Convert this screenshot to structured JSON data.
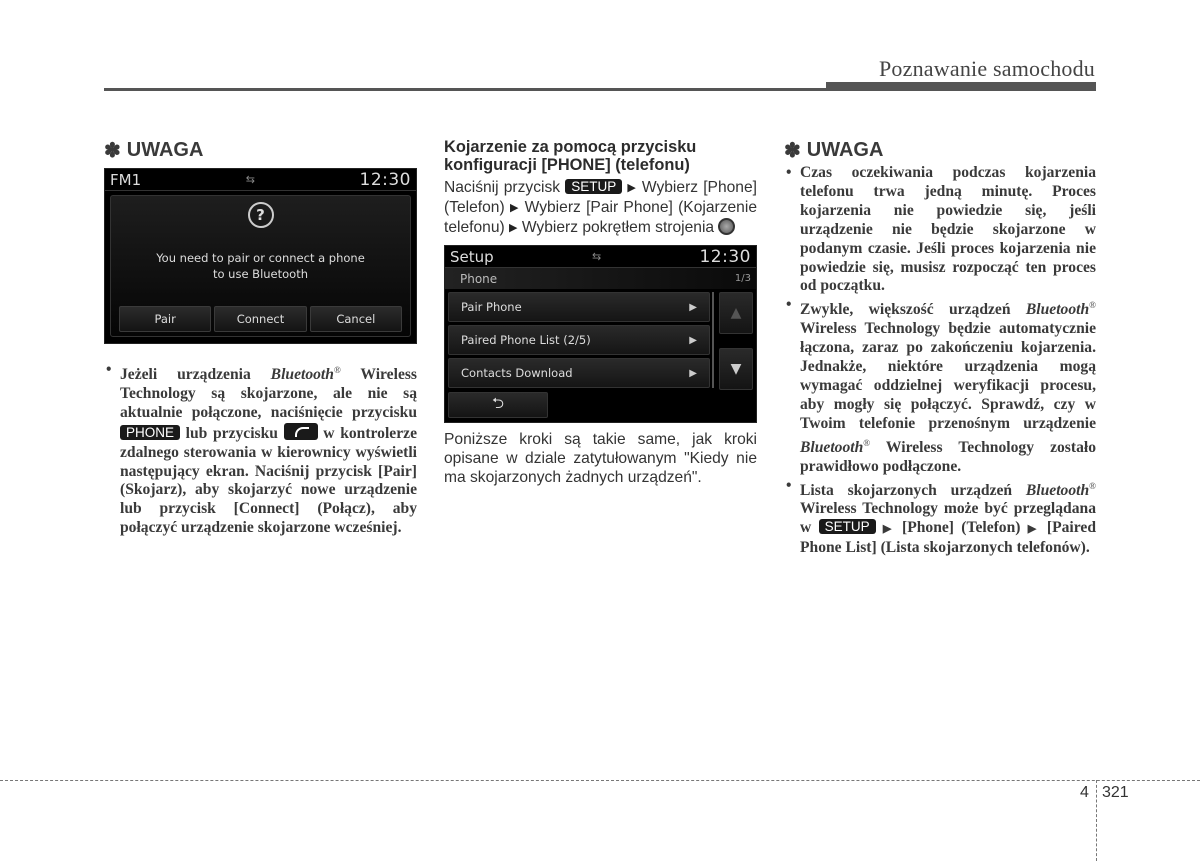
{
  "header": {
    "section_title": "Poznawanie samochodu"
  },
  "left_column": {
    "heading": "UWAGA",
    "heading_symbol": "✽",
    "screen": {
      "source": "FM1",
      "status_icon": "usb-icon",
      "time": "12:30",
      "popup_icon": "question-icon",
      "message_line1": "You need to pair or connect a phone",
      "message_line2": "to use Bluetooth",
      "buttons": [
        "Pair",
        "Connect",
        "Cancel"
      ]
    },
    "bullet": {
      "part1": "Jeżeli urządzenia ",
      "bluetooth": "Bluetooth",
      "reg": "®",
      "part2": " Wireless Technology są skojarzone, ale nie są aktualnie połączone, naciśnięcie przycisku ",
      "phone_key": "PHONE",
      "part3": " lub przycisku ",
      "call_key_icon": "call-icon",
      "part4": " w kontrolerze zdalnego sterowania w kierownicy wyświetli następujący ekran. Naciśnij przycisk [Pair] (Skojarz), aby skojarzyć nowe urządzenie lub przycisk [Connect] (Połącz), aby połączyć urządzenie skojarzone wcześniej."
    }
  },
  "middle_column": {
    "heading": "Kojarzenie za pomocą przycisku konfiguracji [PHONE] (telefonu)",
    "instructions": {
      "part1": "Naciśnij przycisk ",
      "setup_key": "SETUP",
      "arrow": "▶",
      "part2": " Wybierz [Phone] (Telefon) ",
      "part3": " Wybierz [Pair Phone] (Kojarzenie telefonu) ",
      "part4": " Wybierz pokrętłem strojenia "
    },
    "screen": {
      "title": "Setup",
      "status_icon": "usb-icon",
      "time": "12:30",
      "subheader": "Phone",
      "page_indicator": "1/3",
      "menu_items": [
        "Pair Phone",
        "Paired Phone List (2/5)",
        "Contacts Download"
      ],
      "item_arrow": "▶",
      "scroll_up": "▲",
      "scroll_down": "▼",
      "back": "⮌"
    },
    "note": "Poniższe kroki są takie same, jak kroki opisane w dziale zatytułowanym \"Kiedy nie ma skojarzonych żadnych urządzeń\"."
  },
  "right_column": {
    "heading": "UWAGA",
    "heading_symbol": "✽",
    "bullets": {
      "b1": "Czas oczekiwania podczas kojarzenia telefonu trwa jedną minutę. Proces kojarzenia nie powiedzie się, jeśli urządzenie nie będzie skojarzone w podanym czasie. Jeśli proces kojarzenia nie powiedzie się, musisz rozpocząć ten proces od początku.",
      "b2_part1": "Zwykle, większość urządzeń ",
      "b2_part2": " Wireless Technology będzie automatycznie łączona, zaraz po zakończeniu kojarzenia. Jednakże, niektóre urządzenia mogą wymagać oddzielnej weryfikacji procesu, aby mogły się połączyć. Sprawdź, czy w Twoim telefonie przenośnym urządzenie ",
      "b2_part3": " Wireless Technology zostało prawidłowo podłączone.",
      "b3_part1": "Lista skojarzonych urządzeń ",
      "b3_part2": " Wireless Technology może być przeglądana w ",
      "b3_part3": " [Phone] (Telefon) ",
      "b3_part4": " [Paired Phone List] (Lista skojarzonych telefonów).",
      "bluetooth": "Bluetooth",
      "reg": "®",
      "setup_key": "SETUP",
      "arrow": "▶"
    }
  },
  "footer": {
    "chapter": "4",
    "page": "321"
  }
}
